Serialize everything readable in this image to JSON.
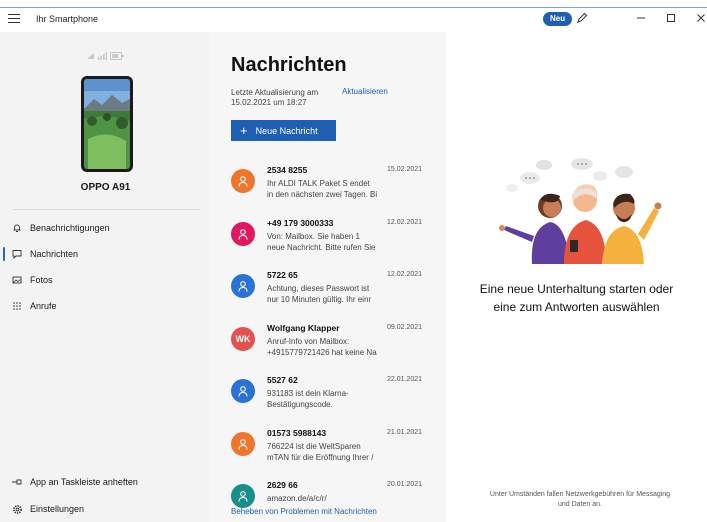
{
  "titlebar": {
    "app_title": "Ihr Smartphone",
    "badge": "Neu",
    "pen_icon": "pen-icon",
    "minimize_icon": "minimize-icon",
    "maximize_icon": "maximize-icon",
    "close_icon": "close-icon"
  },
  "sidebar": {
    "device_name": "OPPO A91",
    "nav": [
      {
        "label": "Benachrichtigungen",
        "icon": "bell-icon"
      },
      {
        "label": "Nachrichten",
        "icon": "message-icon",
        "active": true
      },
      {
        "label": "Fotos",
        "icon": "photos-icon"
      },
      {
        "label": "Anrufe",
        "icon": "dialpad-icon"
      }
    ],
    "bottom": [
      {
        "label": "App an Taskleiste anheften",
        "icon": "pin-icon"
      },
      {
        "label": "Einstellungen",
        "icon": "gear-icon"
      }
    ]
  },
  "messages": {
    "title": "Nachrichten",
    "updated_line1": "Letzte Aktualisierung am",
    "updated_line2": "15.02.2021 um 18:27",
    "refresh": "Aktualisieren",
    "new_message": "Neue Nachricht",
    "conversations": [
      {
        "name": "2534 8255",
        "date": "15.02.2021",
        "line1": "Ihr ALDI TALK Paket S endet",
        "line2": "in den nächsten zwei Tagen. Bi",
        "color": "#f0742a",
        "initials": ""
      },
      {
        "name": "+49 179 3000333",
        "date": "12.02.2021",
        "line1": "Von: Mailbox. Sie haben 1",
        "line2": "neue Nachricht. Bitte rufen Sie",
        "color": "#e3175f",
        "initials": ""
      },
      {
        "name": "5722 65",
        "date": "12.02.2021",
        "line1": "Achtung, dieses Passwort ist",
        "line2": "nur 10 Minuten gültig. Ihr einr",
        "color": "#2b72d6",
        "initials": ""
      },
      {
        "name": "Wolfgang Klapper",
        "date": "09.02.2021",
        "line1": "Anruf-Info von Mailbox:",
        "line2": "+4915779721426 hat keine Na",
        "color": "#e55050",
        "initials": "WK"
      },
      {
        "name": "5527 62",
        "date": "22.01.2021",
        "line1": "931183 ist dein Klarna-",
        "line2": "Bestätigungscode.",
        "color": "#2b72d6",
        "initials": ""
      },
      {
        "name": "01573 5988143",
        "date": "21.01.2021",
        "line1": "766224 ist die WeltSparen",
        "line2": "mTAN für die Eröffnung Ihrer /",
        "color": "#f0742a",
        "initials": ""
      },
      {
        "name": "2629 66",
        "date": "20.01.2021",
        "line1": "amazon.de/a/c/r/",
        "line2": "",
        "color": "#188f8a",
        "initials": ""
      }
    ],
    "troubleshoot": "Beheben von Problemen mit Nachrichten"
  },
  "right_panel": {
    "empty_line1": "Eine neue Unterhaltung starten oder",
    "empty_line2": "eine zum Antworten auswählen",
    "footer_line1": "Unter Umständen fallen Netzwerkgebühren für Messaging",
    "footer_line2": "und Daten an."
  }
}
